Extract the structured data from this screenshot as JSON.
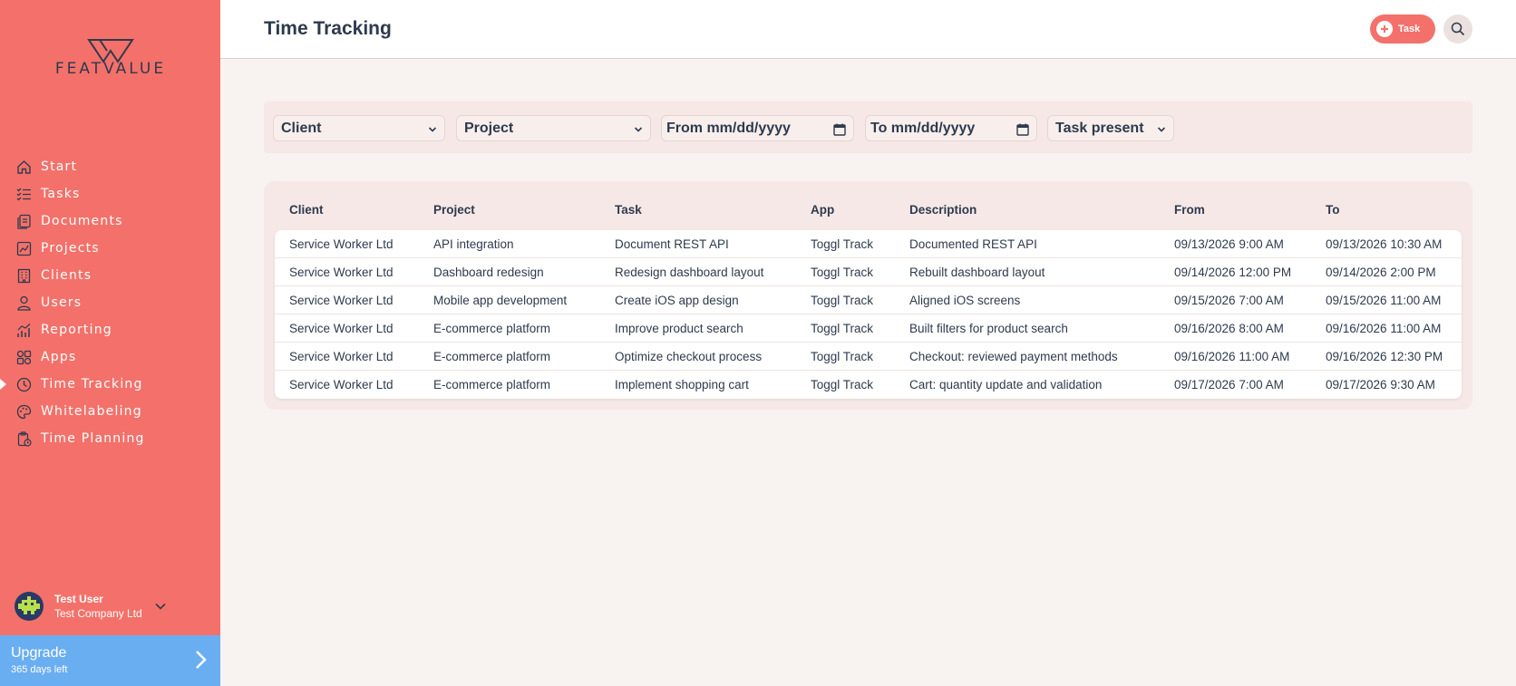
{
  "brand": {
    "name": "FEATVALUE",
    "accent": "#f3716a",
    "upgrade_color": "#6aaef2"
  },
  "sidebar": {
    "items": [
      {
        "label": "Start",
        "icon": "home-icon"
      },
      {
        "label": "Tasks",
        "icon": "checklist-icon"
      },
      {
        "label": "Documents",
        "icon": "documents-icon"
      },
      {
        "label": "Projects",
        "icon": "projects-icon"
      },
      {
        "label": "Clients",
        "icon": "building-icon"
      },
      {
        "label": "Users",
        "icon": "user-icon"
      },
      {
        "label": "Reporting",
        "icon": "chart-icon"
      },
      {
        "label": "Apps",
        "icon": "apps-icon"
      },
      {
        "label": "Time Tracking",
        "icon": "clock-icon",
        "active": true
      },
      {
        "label": "Whitelabeling",
        "icon": "palette-icon"
      },
      {
        "label": "Time Planning",
        "icon": "clipboard-clock-icon"
      }
    ]
  },
  "user": {
    "name": "Test User",
    "company": "Test Company Ltd"
  },
  "upgrade": {
    "title": "Upgrade",
    "subtitle": "365 days left"
  },
  "header": {
    "title": "Time Tracking",
    "task_button": "Task"
  },
  "filters": {
    "client": "Client",
    "project": "Project",
    "from": "From mm/dd/yyyy",
    "to": "To mm/dd/yyyy",
    "task_present": "Task present"
  },
  "table": {
    "columns": [
      "Client",
      "Project",
      "Task",
      "App",
      "Description",
      "From",
      "To"
    ],
    "rows": [
      [
        "Service Worker Ltd",
        "API integration",
        "Document REST API",
        "Toggl Track",
        "Documented REST API",
        "09/13/2026 9:00 AM",
        "09/13/2026 10:30 AM"
      ],
      [
        "Service Worker Ltd",
        "Dashboard redesign",
        "Redesign dashboard layout",
        "Toggl Track",
        "Rebuilt dashboard layout",
        "09/14/2026 12:00 PM",
        "09/14/2026 2:00 PM"
      ],
      [
        "Service Worker Ltd",
        "Mobile app development",
        "Create iOS app design",
        "Toggl Track",
        "Aligned iOS screens",
        "09/15/2026 7:00 AM",
        "09/15/2026 11:00 AM"
      ],
      [
        "Service Worker Ltd",
        "E-commerce platform",
        "Improve product search",
        "Toggl Track",
        "Built filters for product search",
        "09/16/2026 8:00 AM",
        "09/16/2026 11:00 AM"
      ],
      [
        "Service Worker Ltd",
        "E-commerce platform",
        "Optimize checkout process",
        "Toggl Track",
        "Checkout: reviewed payment methods",
        "09/16/2026 11:00 AM",
        "09/16/2026 12:30 PM"
      ],
      [
        "Service Worker Ltd",
        "E-commerce platform",
        "Implement shopping cart",
        "Toggl Track",
        "Cart: quantity update and validation",
        "09/17/2026 7:00 AM",
        "09/17/2026 9:30 AM"
      ]
    ]
  }
}
